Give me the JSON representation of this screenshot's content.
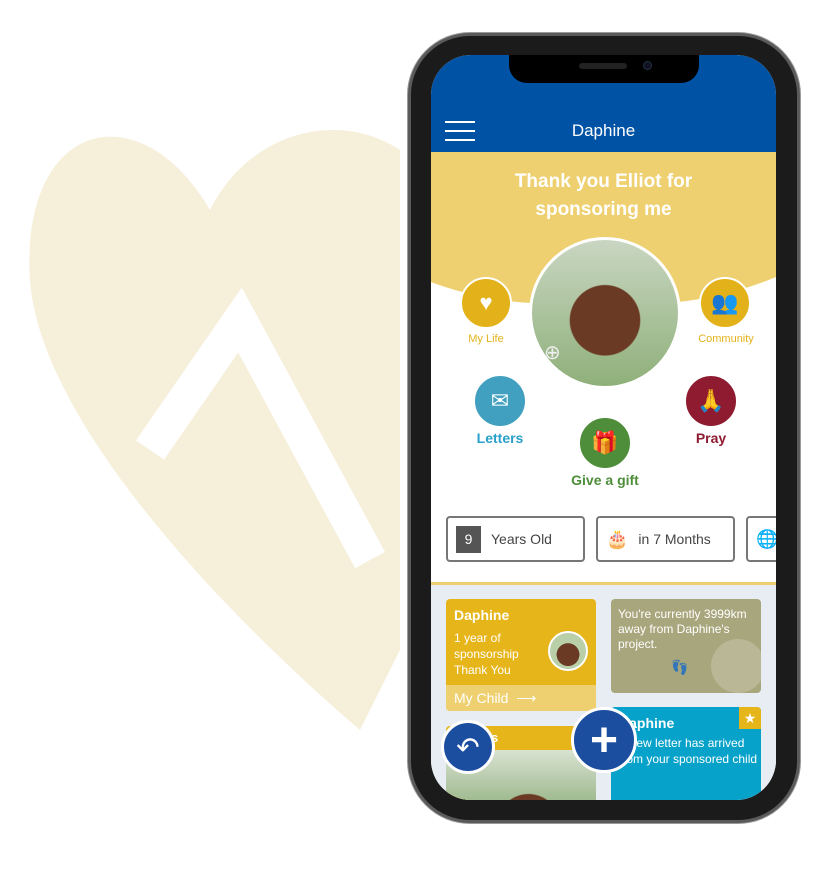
{
  "header": {
    "title": "Daphine"
  },
  "hero": {
    "thanks": "Thank you Elliot for sponsoring me"
  },
  "actions": [
    {
      "label": "My Life",
      "icon": "heart-pulse-icon",
      "color": "#e3b21b"
    },
    {
      "label": "Community",
      "icon": "community-icon",
      "color": "#e3b21b"
    },
    {
      "label": "Letters",
      "icon": "envelope-icon",
      "color": "#41a0c0"
    },
    {
      "label": "Pray",
      "icon": "praying-hands-icon",
      "color": "#8e1b30"
    },
    {
      "label": "Give a gift",
      "icon": "gift-icon",
      "color": "#4e8e3a"
    }
  ],
  "stats": [
    {
      "value": "9",
      "label": "Years Old"
    },
    {
      "label": "in 7 Months",
      "icon": "birthday-cake-icon"
    },
    {
      "icon": "globe-icon"
    }
  ],
  "cards": {
    "child": {
      "name": "Daphine",
      "text": "1 year of sponsorship Thank You",
      "link": "My Child",
      "color": "#e6b51a"
    },
    "distance": {
      "text": "You're currently 3999km away from Daphine's project.",
      "color": "#a8a67c"
    },
    "letter": {
      "name": "Daphine",
      "text": "A new letter has arrived from your sponsored child",
      "color": "#06a2c9"
    },
    "photos": {
      "label": "s"
    }
  },
  "colors": {
    "header": "#0052a5",
    "yellow": "#efd070"
  }
}
